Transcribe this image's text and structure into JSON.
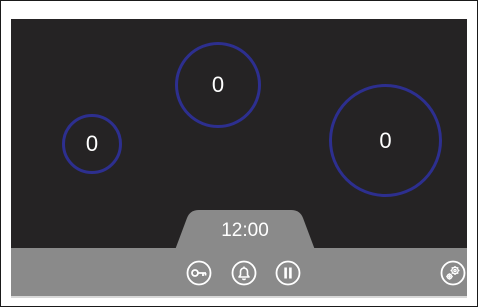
{
  "zones": {
    "small": {
      "value": "0"
    },
    "top": {
      "value": "0"
    },
    "large": {
      "value": "0"
    }
  },
  "timer": {
    "value": "12:00"
  },
  "controls": {
    "lock_icon": "key-icon",
    "bell_icon": "bell-icon",
    "pause_icon": "pause-icon",
    "settings_icon": "gears-icon"
  },
  "colors": {
    "panel": "#252324",
    "zone_ring": "#2d2f8f",
    "bottom_bar": "#8a8a8a",
    "timer_tab": "#8a8a8a",
    "text": "#ffffff"
  }
}
